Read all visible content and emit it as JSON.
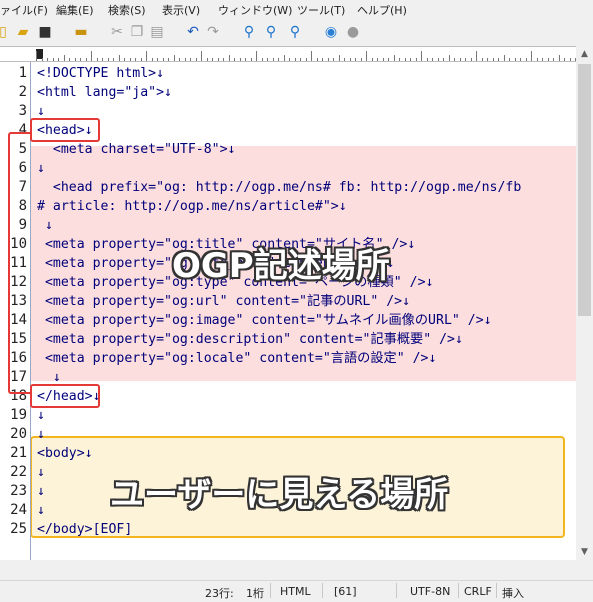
{
  "menu": [
    "ァイル(F)",
    "編集(E)",
    "検索(S)",
    "表示(V)",
    "ウィンドウ(W)",
    "ツール(T)",
    "ヘルプ(H)"
  ],
  "toolbar_icons": [
    "new-file-icon",
    "open-folder-icon",
    "save-icon",
    "print-icon",
    "cut-icon",
    "copy-icon",
    "paste-icon",
    "undo-icon",
    "redo-icon",
    "search-icon",
    "search-next-icon",
    "search-prev-icon",
    "browser-icon",
    "stop-icon"
  ],
  "line_numbers": [
    "1",
    "2",
    "3",
    "4",
    "5",
    "6",
    "7",
    "8",
    "9",
    "10",
    "11",
    "12",
    "13",
    "14",
    "15",
    "16",
    "17",
    "18",
    "19",
    "20",
    "21",
    "22",
    "23",
    "24",
    "25"
  ],
  "code_lines": [
    "<!DOCTYPE html>↓",
    "<html lang=\"ja\">↓",
    "↓",
    "<head>↓",
    "  <meta charset=\"UTF-8\">↓",
    "↓",
    "  <head prefix=\"og: http://ogp.me/ns# fb: http://ogp.me/ns/fb",
    "# article: http://ogp.me/ns/article#\">↓",
    " ↓",
    " <meta property=\"og:title\" content=\"サイト名\" />↓",
    " <meta property=\"og:site_name\" content=\"\" />↓",
    " <meta property=\"og:type\" content=\"ページの種類\" />↓",
    " <meta property=\"og:url\" content=\"記事のURL\" />↓",
    " <meta property=\"og:image\" content=\"サムネイル画像のURL\" />↓",
    " <meta property=\"og:description\" content=\"記事概要\" />↓",
    " <meta property=\"og:locale\" content=\"言語の設定\" />↓",
    "  ↓",
    "</head>↓",
    "↓",
    "↓",
    "<body>↓",
    "↓",
    "↓",
    "↓",
    "</body>[EOF]"
  ],
  "annotations": {
    "ogp_label": "OGP記述場所",
    "body_label": "ユーザーに見える場所"
  },
  "status": {
    "line": "23行:",
    "col": "1桁",
    "mode": "HTML",
    "num": "[61]",
    "encoding": "UTF-8N",
    "newline": "CRLF",
    "insert": "挿入"
  },
  "colors": {
    "ogp_highlight": "#fcdede",
    "body_highlight": "#fdf3d8",
    "red_box": "#e53935",
    "yellow_box": "#f3b61f"
  }
}
